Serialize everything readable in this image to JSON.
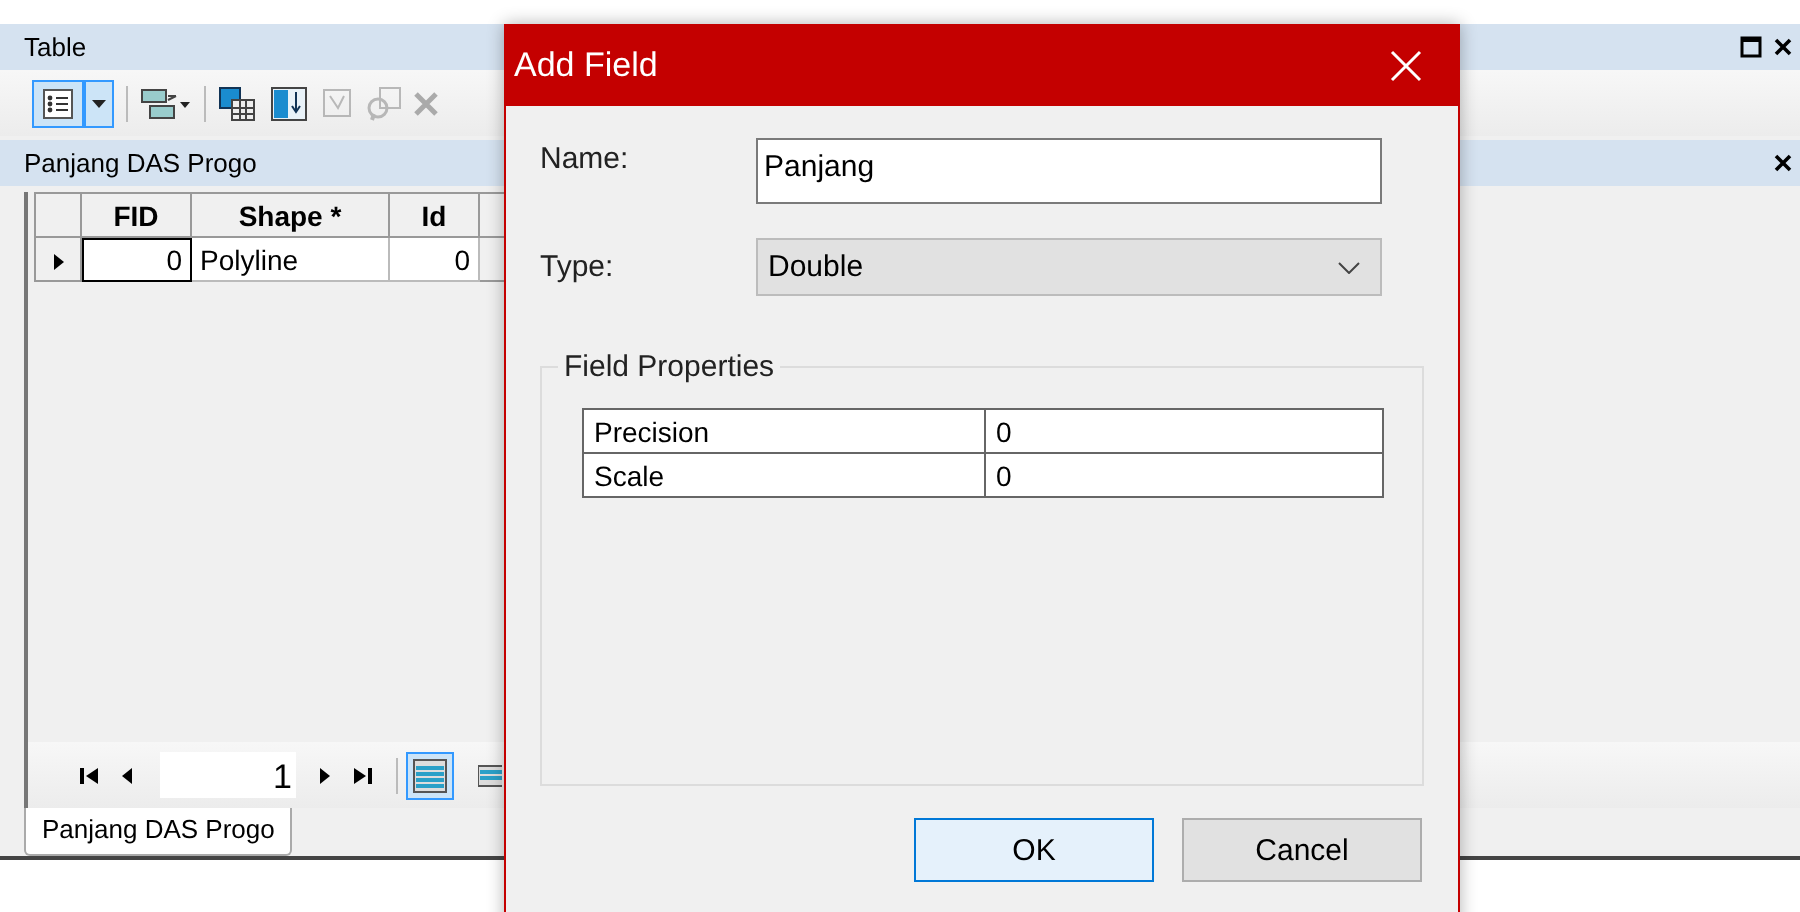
{
  "table_window": {
    "title": "Table"
  },
  "table": {
    "name": "Panjang DAS Progo",
    "columns": [
      "FID",
      "Shape *",
      "Id"
    ],
    "rows": [
      {
        "selected": true,
        "cells": [
          "0",
          "Polyline",
          "0"
        ]
      }
    ]
  },
  "navigator": {
    "record": "1"
  },
  "tabs": [
    {
      "label": "Panjang DAS Progo",
      "selected": true
    }
  ],
  "dialog": {
    "title": "Add Field",
    "name_label": "Name:",
    "name_value": "Panjang",
    "type_label": "Type:",
    "type_value": "Double",
    "group_title": "Field Properties",
    "properties": [
      {
        "label": "Precision",
        "value": "0"
      },
      {
        "label": "Scale",
        "value": "0"
      }
    ],
    "buttons": [
      {
        "label": "OK",
        "default": true
      },
      {
        "label": "Cancel",
        "default": false
      }
    ]
  }
}
